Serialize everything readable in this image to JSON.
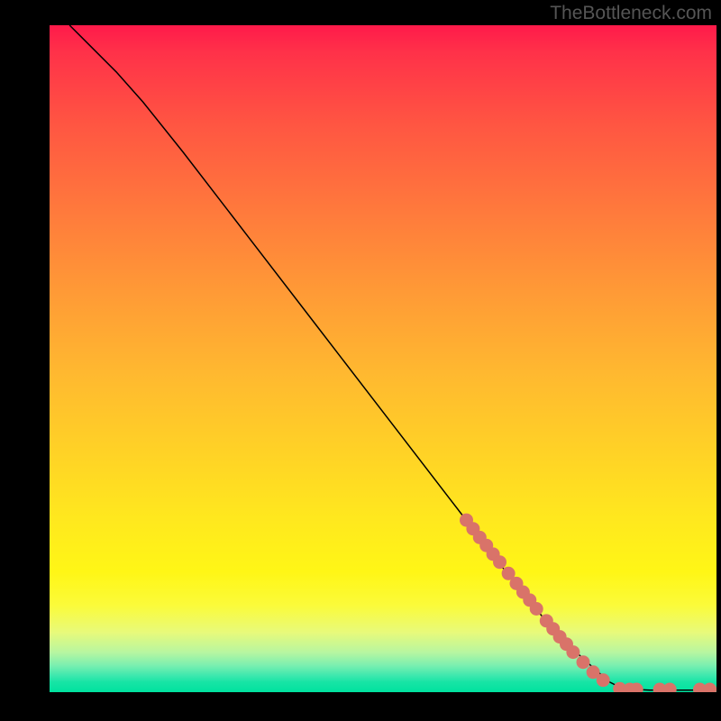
{
  "attribution": "TheBottleneck.com",
  "chart_data": {
    "type": "line",
    "title": "",
    "xlabel": "",
    "ylabel": "",
    "xlim": [
      0,
      100
    ],
    "ylim": [
      0,
      100
    ],
    "curve": [
      {
        "x": 3,
        "y": 100
      },
      {
        "x": 6,
        "y": 97
      },
      {
        "x": 10,
        "y": 93
      },
      {
        "x": 14,
        "y": 88.5
      },
      {
        "x": 20,
        "y": 81
      },
      {
        "x": 30,
        "y": 68
      },
      {
        "x": 40,
        "y": 55
      },
      {
        "x": 50,
        "y": 42
      },
      {
        "x": 60,
        "y": 29
      },
      {
        "x": 65,
        "y": 22.5
      },
      {
        "x": 70,
        "y": 16
      },
      {
        "x": 75,
        "y": 10
      },
      {
        "x": 80,
        "y": 5
      },
      {
        "x": 84,
        "y": 1.5
      },
      {
        "x": 86,
        "y": 0.5
      },
      {
        "x": 90,
        "y": 0.3
      },
      {
        "x": 95,
        "y": 0.3
      },
      {
        "x": 100,
        "y": 0.3
      }
    ],
    "scatter_points": [
      {
        "x": 62.5,
        "y": 25.8
      },
      {
        "x": 63.5,
        "y": 24.5
      },
      {
        "x": 64.5,
        "y": 23.2
      },
      {
        "x": 65.5,
        "y": 22.0
      },
      {
        "x": 66.5,
        "y": 20.7
      },
      {
        "x": 67.5,
        "y": 19.5
      },
      {
        "x": 68.8,
        "y": 17.8
      },
      {
        "x": 70.0,
        "y": 16.3
      },
      {
        "x": 71.0,
        "y": 15.0
      },
      {
        "x": 72.0,
        "y": 13.8
      },
      {
        "x": 73.0,
        "y": 12.5
      },
      {
        "x": 74.5,
        "y": 10.7
      },
      {
        "x": 75.5,
        "y": 9.5
      },
      {
        "x": 76.5,
        "y": 8.3
      },
      {
        "x": 77.5,
        "y": 7.2
      },
      {
        "x": 78.5,
        "y": 6.0
      },
      {
        "x": 80.0,
        "y": 4.5
      },
      {
        "x": 81.5,
        "y": 3.0
      },
      {
        "x": 83.0,
        "y": 1.8
      },
      {
        "x": 85.5,
        "y": 0.5
      },
      {
        "x": 87.0,
        "y": 0.4
      },
      {
        "x": 88.0,
        "y": 0.4
      },
      {
        "x": 91.5,
        "y": 0.4
      },
      {
        "x": 93.0,
        "y": 0.4
      },
      {
        "x": 97.5,
        "y": 0.4
      },
      {
        "x": 99.0,
        "y": 0.4
      }
    ],
    "point_color": "#d97369",
    "line_color": "#000000"
  }
}
